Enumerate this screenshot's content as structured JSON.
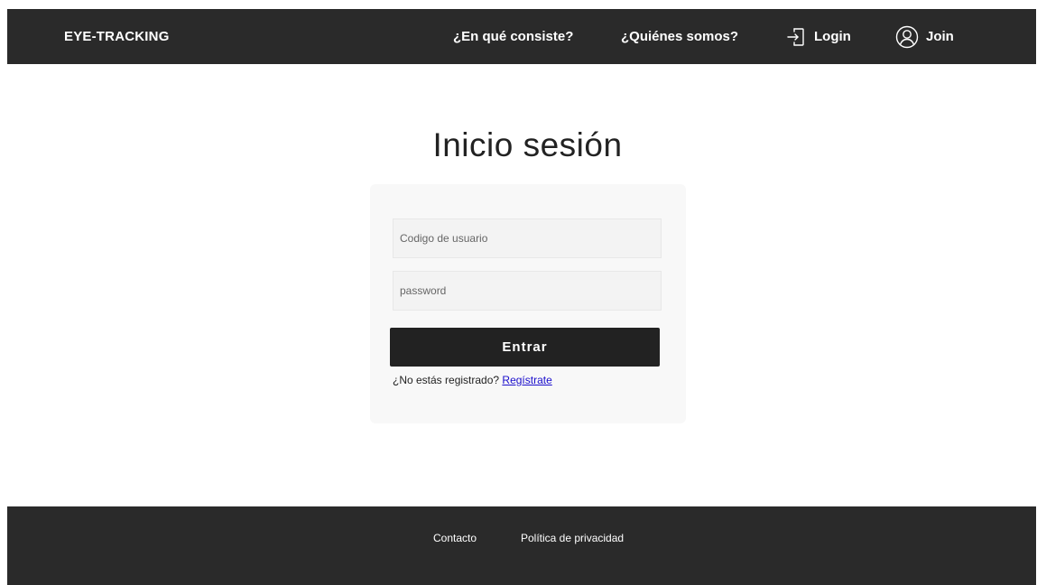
{
  "header": {
    "brand": "EYE-TRACKING",
    "links": [
      {
        "label": "¿En qué consiste?"
      },
      {
        "label": "¿Quiénes somos?"
      },
      {
        "label": "Login",
        "icon": "login-icon"
      },
      {
        "label": "Join",
        "icon": "user-icon"
      }
    ]
  },
  "main": {
    "title": "Inicio sesión",
    "form": {
      "username_placeholder": "Codigo de usuario",
      "password_placeholder": "password",
      "submit_label": "Entrar",
      "register_prompt": "¿No estás registrado?",
      "register_link": "Regístrate"
    }
  },
  "footer": {
    "links": [
      {
        "label": "Contacto"
      },
      {
        "label": "Política de privacidad"
      }
    ]
  },
  "colors": {
    "header_bg": "#2a2a2a",
    "footer_bg": "#2a2a2a",
    "button_bg": "#222222",
    "card_bg": "#f8f8f8",
    "link": "#1a0dcc"
  }
}
